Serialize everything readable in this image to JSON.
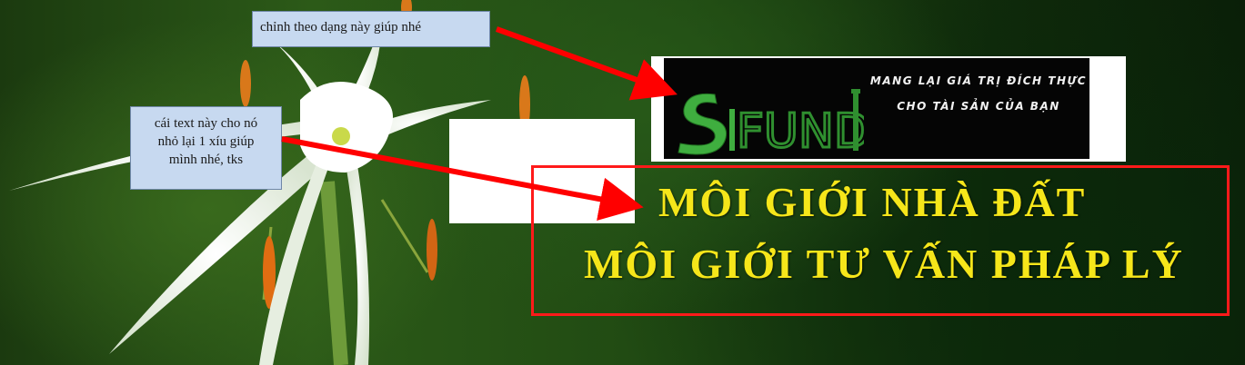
{
  "notes": {
    "note1": "chỉnh theo dạng này giúp nhé",
    "note2_lines": [
      "cái text này cho nó",
      "nhỏ lại 1 xíu giúp",
      "mình nhé, tks"
    ]
  },
  "logo": {
    "brand_s": "S",
    "brand_rest": "FUND",
    "slogan_line1": "MANG LẠI GIÁ TRỊ ĐÍCH THỰC",
    "slogan_line2": "CHO TÀI SẢN CỦA BẠN"
  },
  "headline": {
    "line1": "MÔI GIỚI NHÀ ĐẤT",
    "line2": "MÔI GIỚI TƯ VẤN PHÁP LÝ"
  },
  "colors": {
    "headline_yellow": "#f6e61a",
    "frame_red": "#ff1a1a",
    "arrow_red": "#ff0000",
    "note_bg": "#c7d9f0",
    "brand_green": "#3a9a3a"
  }
}
